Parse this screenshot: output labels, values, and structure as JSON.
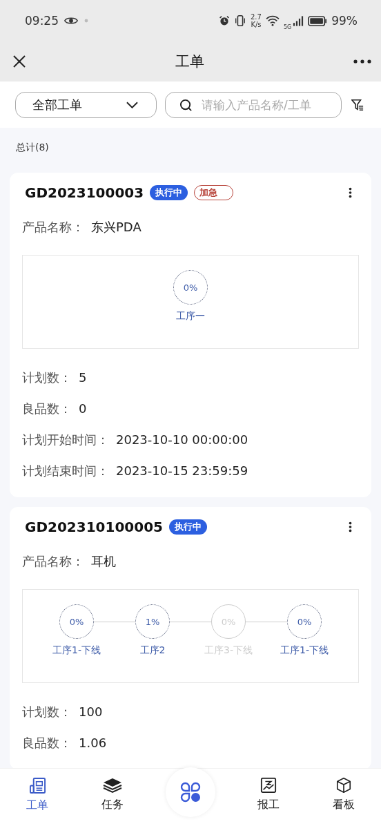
{
  "status_bar": {
    "time": "09:25",
    "speed_value": "2.7",
    "speed_unit": "K/s",
    "network": "5G",
    "battery": "99%"
  },
  "header": {
    "title": "工单"
  },
  "filter": {
    "dropdown": "全部工单",
    "search_placeholder": "请输入产品名称/工单"
  },
  "total": "总计(8)",
  "orders": [
    {
      "code": "GD2023100003",
      "tags": [
        {
          "kind": "status",
          "label": "执行中"
        },
        {
          "kind": "urgent",
          "label": "加急"
        }
      ],
      "product_label": "产品名称：",
      "product": "东兴PDA",
      "steps": [
        {
          "percent": "0%",
          "name": "工序一",
          "disabled": false
        }
      ],
      "fields": [
        {
          "label": "计划数：",
          "value": "5"
        },
        {
          "label": "良品数：",
          "value": "0"
        },
        {
          "label": "计划开始时间：",
          "value": "2023-10-10 00:00:00"
        },
        {
          "label": "计划结束时间：",
          "value": "2023-10-15 23:59:59"
        }
      ]
    },
    {
      "code": "GD202310100005",
      "tags": [
        {
          "kind": "status",
          "label": "执行中"
        }
      ],
      "product_label": "产品名称：",
      "product": "耳机",
      "steps": [
        {
          "percent": "0%",
          "name": "工序1-下线",
          "disabled": false
        },
        {
          "percent": "1%",
          "name": "工序2",
          "disabled": false
        },
        {
          "percent": "0%",
          "name": "工序3-下线",
          "disabled": true
        },
        {
          "percent": "0%",
          "name": "工序1-下线",
          "disabled": false
        }
      ],
      "fields": [
        {
          "label": "计划数：",
          "value": "100"
        },
        {
          "label": "良品数：",
          "value": "1.06"
        }
      ]
    }
  ],
  "tab_bar": [
    {
      "kind": "doc",
      "label": "工单",
      "selected": true
    },
    {
      "kind": "stack",
      "label": "任务",
      "selected": false
    },
    {
      "kind": "center"
    },
    {
      "kind": "report",
      "label": "报工",
      "selected": false
    },
    {
      "kind": "cube",
      "label": "看板",
      "selected": false
    }
  ]
}
